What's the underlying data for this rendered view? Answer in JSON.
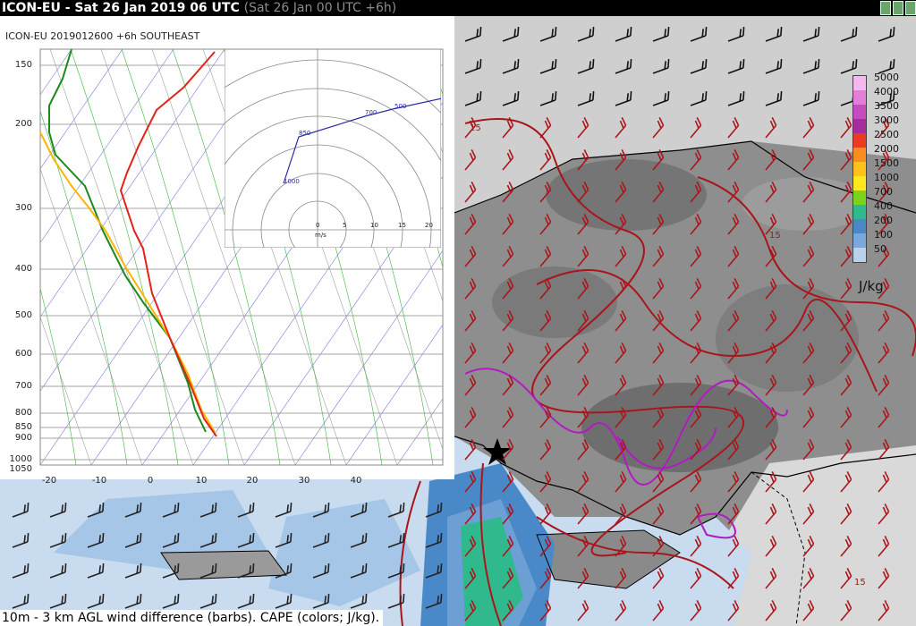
{
  "header": {
    "title": "ICON-EU - Sat 26 Jan 2019 06 UTC",
    "subtitle": "(Sat 26 Jan 00 UTC +6h)"
  },
  "sounding": {
    "title": "ICON-EU 2019012600 +6h SOUTHEAST",
    "pressure_labels": [
      "150",
      "200",
      "300",
      "400",
      "500",
      "600",
      "700",
      "800",
      "850",
      "900",
      "1000",
      "1050"
    ],
    "temp_labels": [
      "-20",
      "-10",
      "0",
      "10",
      "20",
      "30",
      "40"
    ],
    "hodograph": {
      "speed_labels": [
        "0",
        "5",
        "10",
        "15",
        "20"
      ],
      "unit": "m/s",
      "points": [
        "1000",
        "850",
        "700",
        "500"
      ]
    }
  },
  "map": {
    "legend": {
      "values": [
        "5000",
        "4000",
        "3500",
        "3000",
        "2500",
        "2000",
        "1500",
        "1000",
        "700",
        "400",
        "200",
        "100",
        "50"
      ],
      "colors": [
        "#f4b8ee",
        "#e07ed8",
        "#c64bbf",
        "#a82d9c",
        "#ee3a23",
        "#f78f1e",
        "#ffc21a",
        "#ffe81e",
        "#7cd21e",
        "#2fb98c",
        "#4a89c8",
        "#7ba8d8",
        "#b9d1ea"
      ],
      "unit": "J/kg"
    },
    "contour_labels": [
      "15",
      "15",
      "15"
    ],
    "caption": "10m - 3 km AGL wind difference (barbs). CAPE (colors; J/kg)."
  }
}
